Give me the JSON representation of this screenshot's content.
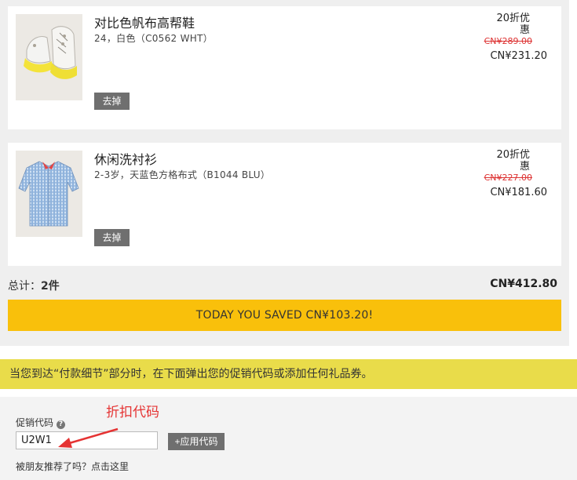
{
  "items": [
    {
      "name": "对比色帆布高帮鞋",
      "variant": "24，白色（C0562 WHT）",
      "remove_label": "去掉",
      "discount": "20折优惠",
      "original_price": "CN¥289.00",
      "price": "CN¥231.20",
      "image_icon": "high-top-sneaker-image"
    },
    {
      "name": "休闲洗衬衫",
      "variant": "2-3岁，天蓝色方格布式（B1044 BLU）",
      "remove_label": "去掉",
      "discount": "20折优惠",
      "original_price": "CN¥227.00",
      "price": "CN¥181.60",
      "image_icon": "blue-gingham-shirt-image"
    }
  ],
  "summary": {
    "total_label": "总计：",
    "total_count": "2件",
    "total_amount": "CN¥412.80",
    "saved_text": "TODAY YOU SAVED CN¥103.20!"
  },
  "notice": {
    "text": "当您到达“付款细节”部分时，在下面弹出您的促销代码或添加任何礼品券。"
  },
  "promo": {
    "label": "促销代码",
    "help_icon": "?",
    "code_value": "U2W1",
    "apply_label": "+应用代码",
    "referral_text": "被朋友推荐了吗？点击这里"
  },
  "annotation": {
    "text": "折扣代码"
  },
  "colors": {
    "saved_bar": "#f9c00b",
    "notice_bar": "#e9dc4a",
    "remove_button": "#6f6f6f",
    "strike_price": "#dd3333",
    "annotation": "#e53333"
  }
}
